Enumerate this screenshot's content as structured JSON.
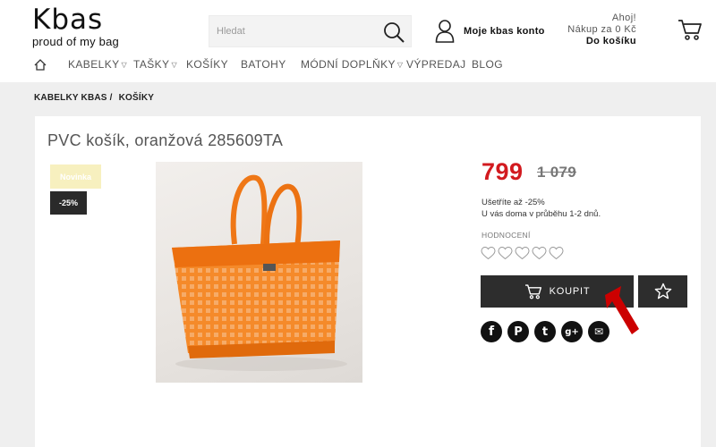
{
  "brand": {
    "logo": "Kbas",
    "tagline": "proud of my bag"
  },
  "search": {
    "placeholder": "Hledat"
  },
  "account": {
    "label": "Moje kbas konto"
  },
  "cart": {
    "greeting": "Ahoj!",
    "summary": "Nákup za 0 Kč",
    "link": "Do košíku"
  },
  "nav": {
    "home_icon": "home-icon",
    "items": [
      {
        "label": "KABELKY",
        "dropdown": true
      },
      {
        "label": "TAŠKY",
        "dropdown": true
      },
      {
        "label": "KOŠÍKY",
        "dropdown": false
      },
      {
        "label": "BATOHY",
        "dropdown": false
      },
      {
        "label": "MÓDNÍ DOPLŇKY",
        "dropdown": true
      },
      {
        "label": "VÝPREDAJ",
        "dropdown": false
      },
      {
        "label": "BLOG",
        "dropdown": false
      }
    ]
  },
  "breadcrumb": {
    "items": [
      "KABELKY KBAS /",
      "KOŠÍKY"
    ]
  },
  "product": {
    "title": "PVC košík, oranžová 285609TA",
    "badge_new": "Novinka",
    "badge_discount": "-25%",
    "price": "799",
    "old_price": "1 079",
    "savings": "Ušetříte až -25%",
    "delivery": "U vás doma v průběhu 1-2 dnů.",
    "rating_label": "HODNOCENÍ",
    "rating_value": 0,
    "rating_max": 5,
    "buy_label": "KOUPIT",
    "image_icon": "orange-basket-image"
  },
  "share": {
    "icons": [
      "facebook-icon",
      "pinterest-icon",
      "twitter-icon",
      "googleplus-icon",
      "email-icon"
    ],
    "glyphs": [
      "f",
      "P",
      "t",
      "g+",
      "✉"
    ]
  },
  "colors": {
    "price": "#d21a1f",
    "dark_button": "#2d2d2d",
    "badge_new": "#f7f0bf",
    "product": "#f07a1a",
    "annotation_arrow": "#cc0000"
  }
}
